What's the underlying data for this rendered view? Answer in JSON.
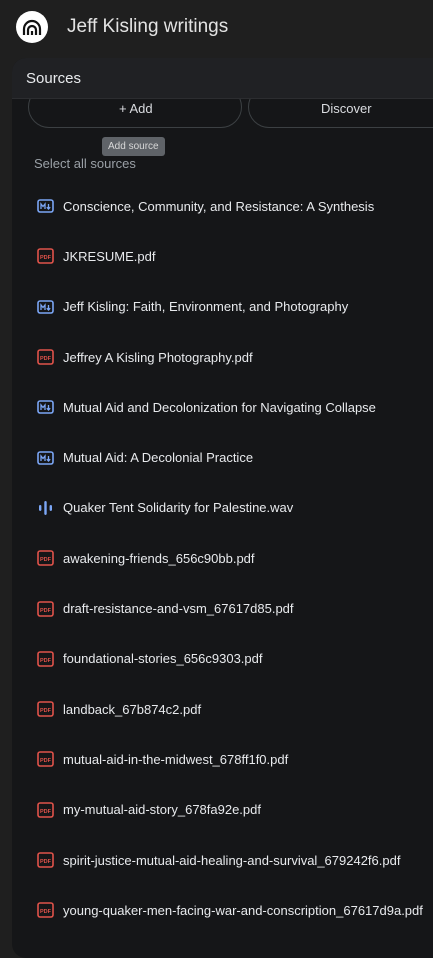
{
  "app": {
    "title": "Jeff Kisling writings"
  },
  "panel": {
    "title": "Sources",
    "add_label": "+ Add",
    "discover_label": "Discover",
    "tooltip": "Add source",
    "select_all": "Select all sources"
  },
  "sources": [
    {
      "type": "markdown",
      "name": "Conscience, Community, and Resistance: A Synthesis"
    },
    {
      "type": "pdf",
      "name": "JKRESUME.pdf"
    },
    {
      "type": "markdown",
      "name": "Jeff Kisling: Faith, Environment, and Photography"
    },
    {
      "type": "pdf",
      "name": "Jeffrey A Kisling Photography.pdf"
    },
    {
      "type": "markdown",
      "name": "Mutual Aid and Decolonization for Navigating Collapse"
    },
    {
      "type": "markdown",
      "name": "Mutual Aid: A Decolonial Practice"
    },
    {
      "type": "audio",
      "name": "Quaker Tent Solidarity for Palestine.wav"
    },
    {
      "type": "pdf",
      "name": "awakening-friends_656c90bb.pdf"
    },
    {
      "type": "pdf",
      "name": "draft-resistance-and-vsm_67617d85.pdf"
    },
    {
      "type": "pdf",
      "name": "foundational-stories_656c9303.pdf"
    },
    {
      "type": "pdf",
      "name": "landback_67b874c2.pdf"
    },
    {
      "type": "pdf",
      "name": "mutual-aid-in-the-midwest_678ff1f0.pdf"
    },
    {
      "type": "pdf",
      "name": "my-mutual-aid-story_678fa92e.pdf"
    },
    {
      "type": "pdf",
      "name": "spirit-justice-mutual-aid-healing-and-survival_679242f6.pdf"
    },
    {
      "type": "pdf",
      "name": "young-quaker-men-facing-war-and-conscription_67617d9a.pdf"
    }
  ],
  "icons": {
    "pdf": "pdf-icon",
    "markdown": "markdown-icon",
    "audio": "audio-icon"
  },
  "colors": {
    "pdf": "#e0534a",
    "markdown": "#7ba6f5",
    "audio": "#7ba6f5"
  }
}
